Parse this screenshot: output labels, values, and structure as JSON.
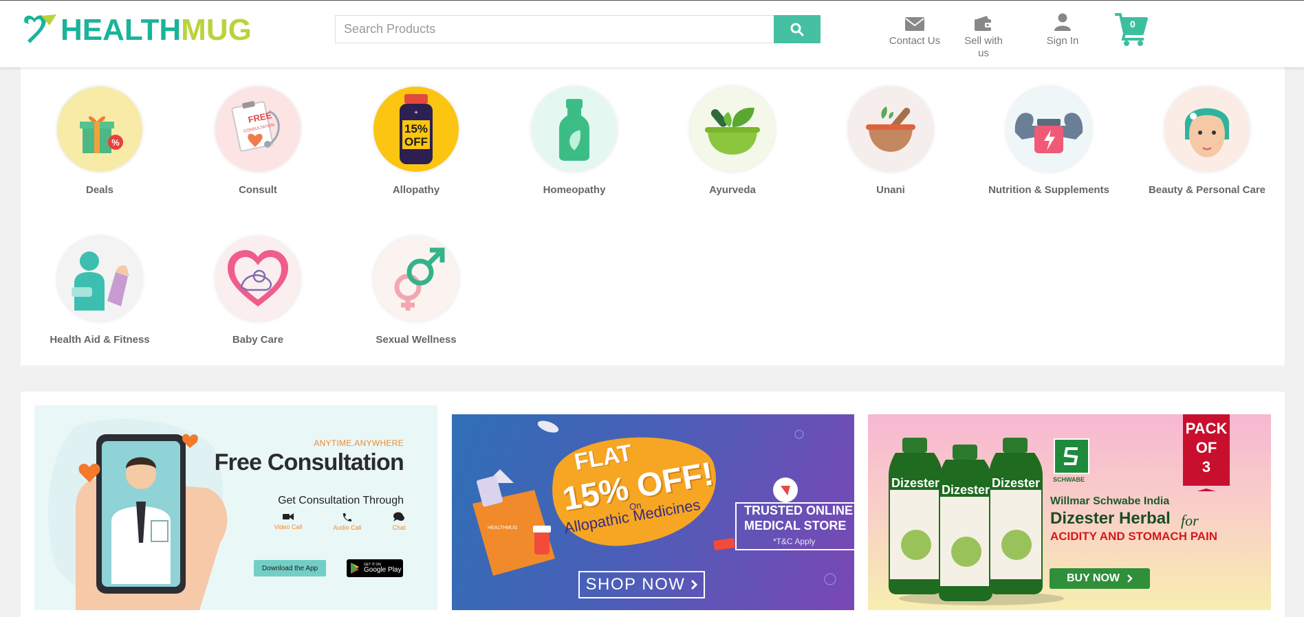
{
  "brand": {
    "part1": "HEALTH",
    "part2": "MUG"
  },
  "search": {
    "placeholder": "Search Products"
  },
  "nav": {
    "contact": "Contact Us",
    "sell_line1": "Sell with",
    "sell_line2": "us",
    "signin": "Sign In",
    "cart_count": "0"
  },
  "categories": [
    {
      "label": "Deals",
      "icon": "gift-icon"
    },
    {
      "label": "Consult",
      "icon": "clipboard-stethoscope-icon"
    },
    {
      "label": "Allopathy",
      "icon": "medicine-bottle-icon",
      "badge_line1": "15%",
      "badge_line2": "OFF"
    },
    {
      "label": "Homeopathy",
      "icon": "homeopathy-bottle-icon"
    },
    {
      "label": "Ayurveda",
      "icon": "mortar-leaf-icon"
    },
    {
      "label": "Unani",
      "icon": "mortar-pestle-icon"
    },
    {
      "label": "Nutrition & Supplements",
      "icon": "supplement-jar-icon"
    },
    {
      "label": "Beauty & Personal Care",
      "icon": "face-icon"
    },
    {
      "label": "Health Aid & Fitness",
      "icon": "arm-sling-icon"
    },
    {
      "label": "Baby Care",
      "icon": "baby-heart-icon"
    },
    {
      "label": "Sexual Wellness",
      "icon": "gender-symbols-icon"
    }
  ],
  "consult_card": {
    "free_line1": "FREE",
    "free_line2": "CONSULTATION"
  },
  "banners": {
    "consultation": {
      "tagline": "ANYTIME.ANYWHERE",
      "title": "Free Consultation",
      "subtitle": "Get Consultation Through",
      "video": "Video Call",
      "audio": "Audio Call",
      "chat": "Chat",
      "download": "Download the App",
      "play_small": "GET IT ON",
      "play_big": "Google Play"
    },
    "allopathy": {
      "flat": "FLAT",
      "offer": "15% OFF!",
      "on": "On",
      "category": "Allopathic Medicines",
      "trusted_line1": "TRUSTED ONLINE",
      "trusted_line2": "MEDICAL STORE",
      "tc": "*T&C Apply",
      "cta": "SHOP NOW",
      "bag_brand": "HEALTHMUG"
    },
    "dizester": {
      "pack_line1": "PACK",
      "pack_line2": "OF",
      "pack_line3": "3",
      "company": "Willmar Schwabe India",
      "product": "Dizester Herbal",
      "for": "for",
      "use": "ACIDITY AND STOMACH PAIN",
      "cta": "BUY NOW",
      "bottle_label": "Dizester",
      "logo_text": "SCHWABE"
    }
  },
  "colors": {
    "brand_teal": "#1bb39a",
    "brand_lime": "#b9d33b",
    "search_button": "#45c0a2",
    "cart": "#3cbf9f"
  }
}
